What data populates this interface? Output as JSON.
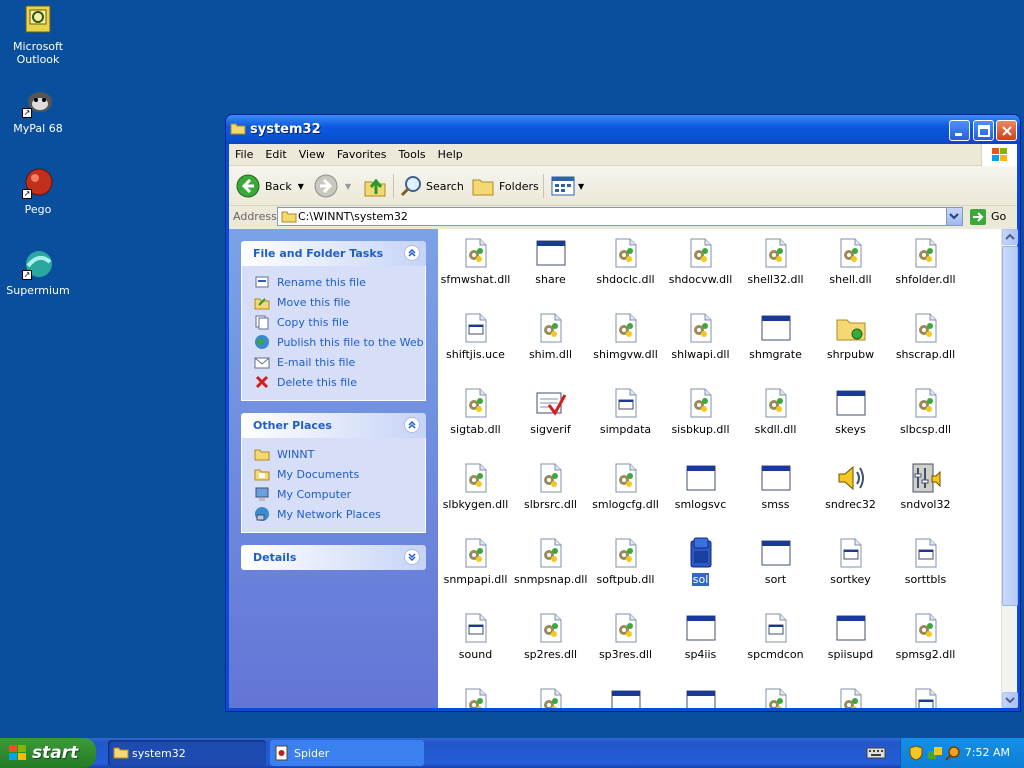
{
  "desktop": {
    "icons": [
      {
        "label": "Microsoft Outlook"
      },
      {
        "label": "MyPal 68"
      },
      {
        "label": "Pego"
      },
      {
        "label": "Supermium"
      }
    ]
  },
  "window": {
    "title": "system32",
    "menu": [
      "File",
      "Edit",
      "View",
      "Favorites",
      "Tools",
      "Help"
    ],
    "toolbar": {
      "back": "Back",
      "search": "Search",
      "folders": "Folders"
    },
    "address": {
      "label": "Address",
      "value": "C:\\WINNT\\system32",
      "go": "Go"
    }
  },
  "taskpane": {
    "file_tasks": {
      "title": "File and Folder Tasks",
      "items": [
        "Rename this file",
        "Move this file",
        "Copy this file",
        "Publish this file to the Web",
        "E-mail this file",
        "Delete this file"
      ]
    },
    "other_places": {
      "title": "Other Places",
      "items": [
        "WINNT",
        "My Documents",
        "My Computer",
        "My Network Places"
      ]
    },
    "details": {
      "title": "Details"
    }
  },
  "files": [
    {
      "name": "sfmwshat.dll",
      "icon": "dll"
    },
    {
      "name": "share",
      "icon": "exe"
    },
    {
      "name": "shdoclc.dll",
      "icon": "dll"
    },
    {
      "name": "shdocvw.dll",
      "icon": "dll"
    },
    {
      "name": "shell32.dll",
      "icon": "dll"
    },
    {
      "name": "shell.dll",
      "icon": "dll"
    },
    {
      "name": "shfolder.dll",
      "icon": "dll"
    },
    {
      "name": "shiftjis.uce",
      "icon": "file"
    },
    {
      "name": "shim.dll",
      "icon": "dll"
    },
    {
      "name": "shimgvw.dll",
      "icon": "dll"
    },
    {
      "name": "shlwapi.dll",
      "icon": "dll"
    },
    {
      "name": "shmgrate",
      "icon": "exe"
    },
    {
      "name": "shrpubw",
      "icon": "folder"
    },
    {
      "name": "shscrap.dll",
      "icon": "dll"
    },
    {
      "name": "sigtab.dll",
      "icon": "dll"
    },
    {
      "name": "sigverif",
      "icon": "sigverif"
    },
    {
      "name": "simpdata",
      "icon": "file"
    },
    {
      "name": "sisbkup.dll",
      "icon": "dll"
    },
    {
      "name": "skdll.dll",
      "icon": "dll"
    },
    {
      "name": "skeys",
      "icon": "exe"
    },
    {
      "name": "slbcsp.dll",
      "icon": "dll"
    },
    {
      "name": "slbkygen.dll",
      "icon": "dll"
    },
    {
      "name": "slbrsrc.dll",
      "icon": "dll"
    },
    {
      "name": "smlogcfg.dll",
      "icon": "dll"
    },
    {
      "name": "smlogsvc",
      "icon": "exe"
    },
    {
      "name": "smss",
      "icon": "exe"
    },
    {
      "name": "sndrec32",
      "icon": "speaker"
    },
    {
      "name": "sndvol32",
      "icon": "sndvol"
    },
    {
      "name": "snmpapi.dll",
      "icon": "dll"
    },
    {
      "name": "snmpsnap.dll",
      "icon": "dll"
    },
    {
      "name": "softpub.dll",
      "icon": "dll"
    },
    {
      "name": "sol",
      "icon": "cards",
      "selected": true
    },
    {
      "name": "sort",
      "icon": "exe"
    },
    {
      "name": "sortkey",
      "icon": "file"
    },
    {
      "name": "sorttbls",
      "icon": "file"
    },
    {
      "name": "sound",
      "icon": "file"
    },
    {
      "name": "sp2res.dll",
      "icon": "dll"
    },
    {
      "name": "sp3res.dll",
      "icon": "dll"
    },
    {
      "name": "sp4iis",
      "icon": "exe"
    },
    {
      "name": "spcmdcon",
      "icon": "file"
    },
    {
      "name": "spiisupd",
      "icon": "exe"
    },
    {
      "name": "spmsg2.dll",
      "icon": "dll"
    },
    {
      "name": "",
      "icon": "dll"
    },
    {
      "name": "",
      "icon": "dll"
    },
    {
      "name": "",
      "icon": "exe"
    },
    {
      "name": "",
      "icon": "exe"
    },
    {
      "name": "",
      "icon": "dll"
    },
    {
      "name": "",
      "icon": "dll"
    },
    {
      "name": "",
      "icon": "file"
    }
  ],
  "taskbar": {
    "start": "start",
    "buttons": [
      {
        "label": "system32"
      },
      {
        "label": "Spider"
      }
    ],
    "clock": "7:52 AM"
  }
}
